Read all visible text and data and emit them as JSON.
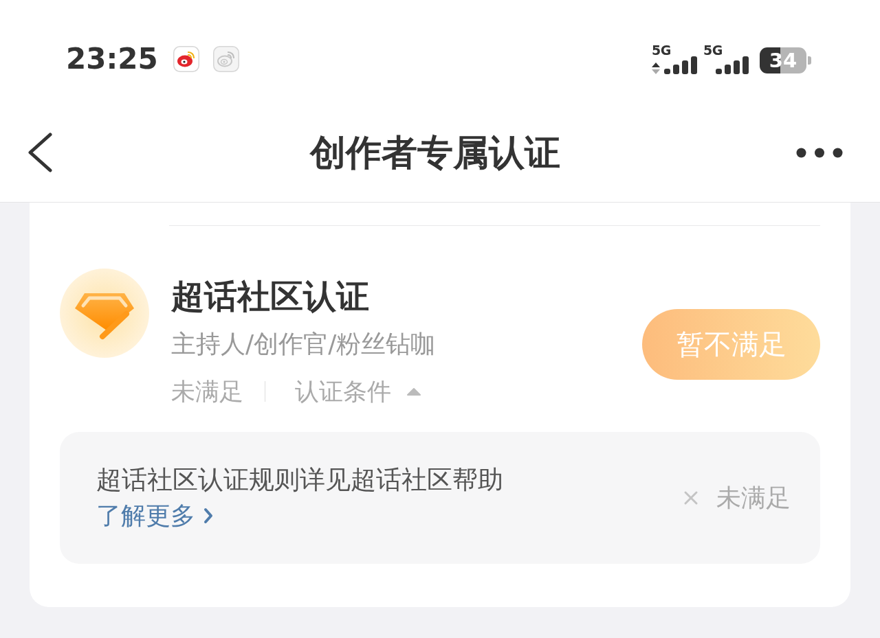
{
  "status_bar": {
    "time": "23:25",
    "signals": [
      {
        "label": "5G",
        "data_active": true
      },
      {
        "label": "5G",
        "data_active": false
      }
    ],
    "battery": "34"
  },
  "nav": {
    "title": "创作者专属认证"
  },
  "certification": {
    "title": "超话社区认证",
    "subtitle": "主持人/创作官/粉丝钻咖",
    "status": "未满足",
    "toggle": {
      "label": "认证条件",
      "expanded": true
    },
    "button": {
      "label": "暂不满足",
      "disabled": true
    }
  },
  "conditions": [
    {
      "text": "超话社区认证规则详见超话社区帮助",
      "link": "了解更多",
      "met": false,
      "status": "未满足"
    }
  ]
}
